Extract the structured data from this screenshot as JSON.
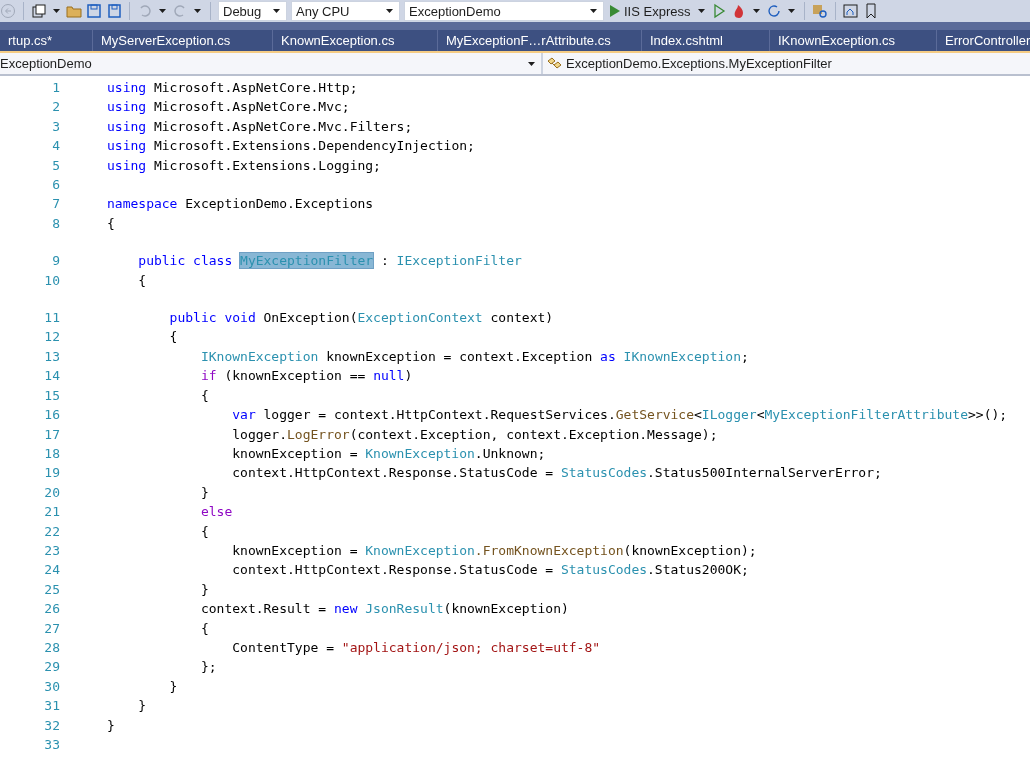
{
  "toolbar": {
    "configuration": "Debug",
    "platform": "Any CPU",
    "startup_project": "ExceptionDemo",
    "run_target": "IIS Express"
  },
  "tabs": [
    {
      "label": "rtup.cs*",
      "selected": false
    },
    {
      "label": "MyServerException.cs",
      "selected": false
    },
    {
      "label": "KnownException.cs",
      "selected": false
    },
    {
      "label": "MyExceptionF…rAttribute.cs",
      "selected": false
    },
    {
      "label": "Index.cshtml",
      "selected": false
    },
    {
      "label": "IKnownException.cs",
      "selected": false
    },
    {
      "label": "ErrorController",
      "selected": false
    }
  ],
  "navigation_bar": {
    "project": "ExceptionDemo",
    "member": "ExceptionDemo.Exceptions.MyExceptionFilter"
  },
  "code": {
    "lines": [
      {
        "number": "1",
        "kind": "normal",
        "tokens": [
          {
            "text": "using",
            "kind": "keyword"
          },
          {
            "text": " Microsoft.AspNetCore.Http;",
            "kind": "plain"
          }
        ]
      },
      {
        "number": "2",
        "kind": "normal",
        "tokens": [
          {
            "text": "using",
            "kind": "keyword"
          },
          {
            "text": " Microsoft.AspNetCore.Mvc;",
            "kind": "plain"
          }
        ]
      },
      {
        "number": "3",
        "kind": "normal",
        "tokens": [
          {
            "text": "using",
            "kind": "keyword"
          },
          {
            "text": " Microsoft.AspNetCore.Mvc.Filters;",
            "kind": "plain"
          }
        ]
      },
      {
        "number": "4",
        "kind": "normal",
        "tokens": [
          {
            "text": "using",
            "kind": "keyword"
          },
          {
            "text": " Microsoft.Extensions.DependencyInjection;",
            "kind": "plain"
          }
        ]
      },
      {
        "number": "5",
        "kind": "normal",
        "tokens": [
          {
            "text": "using",
            "kind": "keyword"
          },
          {
            "text": " Microsoft.Extensions.Logging;",
            "kind": "plain"
          }
        ]
      },
      {
        "number": "6",
        "kind": "normal"
      },
      {
        "number": "7",
        "kind": "normal",
        "tokens": [
          {
            "text": "namespace",
            "kind": "keyword"
          },
          {
            "text": " ExceptionDemo.Exceptions",
            "kind": "plain"
          }
        ]
      },
      {
        "number": "8",
        "kind": "normal",
        "tokens": [
          {
            "text": "{",
            "kind": "plain"
          }
        ]
      },
      {
        "number": "9",
        "kind": "spaced",
        "tokens": [
          {
            "text": "    public class ",
            "kind": "keyword"
          },
          {
            "text": "MyExceptionFilter",
            "kind": "highlighted"
          },
          {
            "text": " : ",
            "kind": "plain"
          },
          {
            "text": "IExceptionFilter",
            "kind": "type"
          }
        ]
      },
      {
        "number": "10",
        "kind": "normal",
        "tokens": [
          {
            "text": "    {",
            "kind": "plain"
          }
        ]
      },
      {
        "number": "11",
        "kind": "spaced",
        "tokens": [
          {
            "text": "        public void",
            "kind": "keyword"
          },
          {
            "text": " OnException(",
            "kind": "plain"
          },
          {
            "text": "ExceptionContext",
            "kind": "type"
          },
          {
            "text": " context)",
            "kind": "plain"
          }
        ]
      },
      {
        "number": "12",
        "kind": "normal",
        "tokens": [
          {
            "text": "        {",
            "kind": "plain"
          }
        ]
      },
      {
        "number": "13",
        "kind": "normal",
        "tokens": [
          {
            "text": "            IKnownException",
            "kind": "type"
          },
          {
            "text": " knownException = context.Exception ",
            "kind": "plain"
          },
          {
            "text": "as ",
            "kind": "keyword"
          },
          {
            "text": "IKnownException",
            "kind": "type"
          },
          {
            "text": ";",
            "kind": "plain"
          }
        ]
      },
      {
        "number": "14",
        "kind": "normal",
        "tokens": [
          {
            "text": "            if",
            "kind": "control"
          },
          {
            "text": " (knownException == ",
            "kind": "plain"
          },
          {
            "text": "null",
            "kind": "keyword"
          },
          {
            "text": ")",
            "kind": "plain"
          }
        ]
      },
      {
        "number": "15",
        "kind": "normal",
        "tokens": [
          {
            "text": "            {",
            "kind": "plain"
          }
        ]
      },
      {
        "number": "16",
        "kind": "normal",
        "tokens": [
          {
            "text": "                var",
            "kind": "keyword"
          },
          {
            "text": " logger = context.HttpContext.RequestServices.",
            "kind": "plain"
          },
          {
            "text": "GetService",
            "kind": "method"
          },
          {
            "text": "<",
            "kind": "plain"
          },
          {
            "text": "ILogger",
            "kind": "type"
          },
          {
            "text": "<",
            "kind": "plain"
          },
          {
            "text": "MyExceptionFilterAttribute",
            "kind": "type"
          },
          {
            "text": ">>();",
            "kind": "plain"
          }
        ]
      },
      {
        "number": "17",
        "kind": "normal",
        "tokens": [
          {
            "text": "                logger.",
            "kind": "plain"
          },
          {
            "text": "LogError",
            "kind": "method"
          },
          {
            "text": "(context.Exception, context.Exception.Message);",
            "kind": "plain"
          }
        ]
      },
      {
        "number": "18",
        "kind": "normal",
        "tokens": [
          {
            "text": "                knownException = ",
            "kind": "plain"
          },
          {
            "text": "KnownException",
            "kind": "type"
          },
          {
            "text": ".Unknown;",
            "kind": "plain"
          }
        ]
      },
      {
        "number": "19",
        "kind": "normal",
        "tokens": [
          {
            "text": "                context.HttpContext.Response.StatusCode = ",
            "kind": "plain"
          },
          {
            "text": "StatusCodes",
            "kind": "type"
          },
          {
            "text": ".Status500InternalServerError;",
            "kind": "plain"
          }
        ]
      },
      {
        "number": "20",
        "kind": "normal",
        "tokens": [
          {
            "text": "            }",
            "kind": "plain"
          }
        ]
      },
      {
        "number": "21",
        "kind": "normal",
        "tokens": [
          {
            "text": "            else",
            "kind": "control"
          }
        ]
      },
      {
        "number": "22",
        "kind": "normal",
        "tokens": [
          {
            "text": "            {",
            "kind": "plain"
          }
        ]
      },
      {
        "number": "23",
        "kind": "normal",
        "tokens": [
          {
            "text": "                knownException = ",
            "kind": "plain"
          },
          {
            "text": "KnownException",
            "kind": "type"
          },
          {
            "text": ".FromKnownException",
            "kind": "method"
          },
          {
            "text": "(knownException);",
            "kind": "plain"
          }
        ]
      },
      {
        "number": "24",
        "kind": "normal",
        "tokens": [
          {
            "text": "                context.HttpContext.Response.StatusCode = ",
            "kind": "plain"
          },
          {
            "text": "StatusCodes",
            "kind": "type"
          },
          {
            "text": ".Status200OK;",
            "kind": "plain"
          }
        ]
      },
      {
        "number": "25",
        "kind": "normal",
        "tokens": [
          {
            "text": "            }",
            "kind": "plain"
          }
        ]
      },
      {
        "number": "26",
        "kind": "normal",
        "tokens": [
          {
            "text": "            context.Result = ",
            "kind": "plain"
          },
          {
            "text": "new ",
            "kind": "keyword"
          },
          {
            "text": "JsonResult",
            "kind": "type"
          },
          {
            "text": "(knownException)",
            "kind": "plain"
          }
        ]
      },
      {
        "number": "27",
        "kind": "normal",
        "tokens": [
          {
            "text": "            {",
            "kind": "plain"
          }
        ]
      },
      {
        "number": "28",
        "kind": "normal",
        "tokens": [
          {
            "text": "                ContentType = ",
            "kind": "plain"
          },
          {
            "text": "\"application/json; charset=utf-8\"",
            "kind": "string"
          }
        ]
      },
      {
        "number": "29",
        "kind": "normal",
        "tokens": [
          {
            "text": "            };",
            "kind": "plain"
          }
        ]
      },
      {
        "number": "30",
        "kind": "normal",
        "tokens": [
          {
            "text": "        }",
            "kind": "plain"
          }
        ]
      },
      {
        "number": "31",
        "kind": "normal",
        "tokens": [
          {
            "text": "    }",
            "kind": "plain"
          }
        ]
      },
      {
        "number": "32",
        "kind": "normal",
        "tokens": [
          {
            "text": "}",
            "kind": "plain"
          }
        ]
      },
      {
        "number": "33",
        "kind": "normal"
      }
    ]
  }
}
